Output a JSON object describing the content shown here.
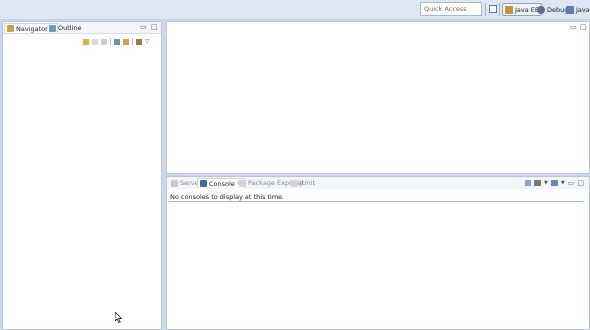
{
  "toolbar": {
    "quick_access_placeholder": "Quick Access",
    "perspectives": [
      {
        "label": "Java EE",
        "active": true
      },
      {
        "label": "Debug",
        "active": false
      },
      {
        "label": "Java",
        "active": false
      }
    ]
  },
  "left_panel": {
    "tabs": [
      {
        "label": "Navigator",
        "active": true
      },
      {
        "label": "Outline",
        "active": false
      }
    ]
  },
  "bottom_panel": {
    "tabs": [
      {
        "label": "Servers",
        "active": false
      },
      {
        "label": "Console",
        "active": true
      },
      {
        "label": "Package Explorer",
        "active": false
      },
      {
        "label": "JUnit",
        "active": false
      }
    ],
    "console_message": "No consoles to display at this time."
  },
  "colors": {
    "workbench_bg": "#cad8e8",
    "panel_bg": "#ffffff",
    "toolbar_bg": "#dde7f3"
  }
}
